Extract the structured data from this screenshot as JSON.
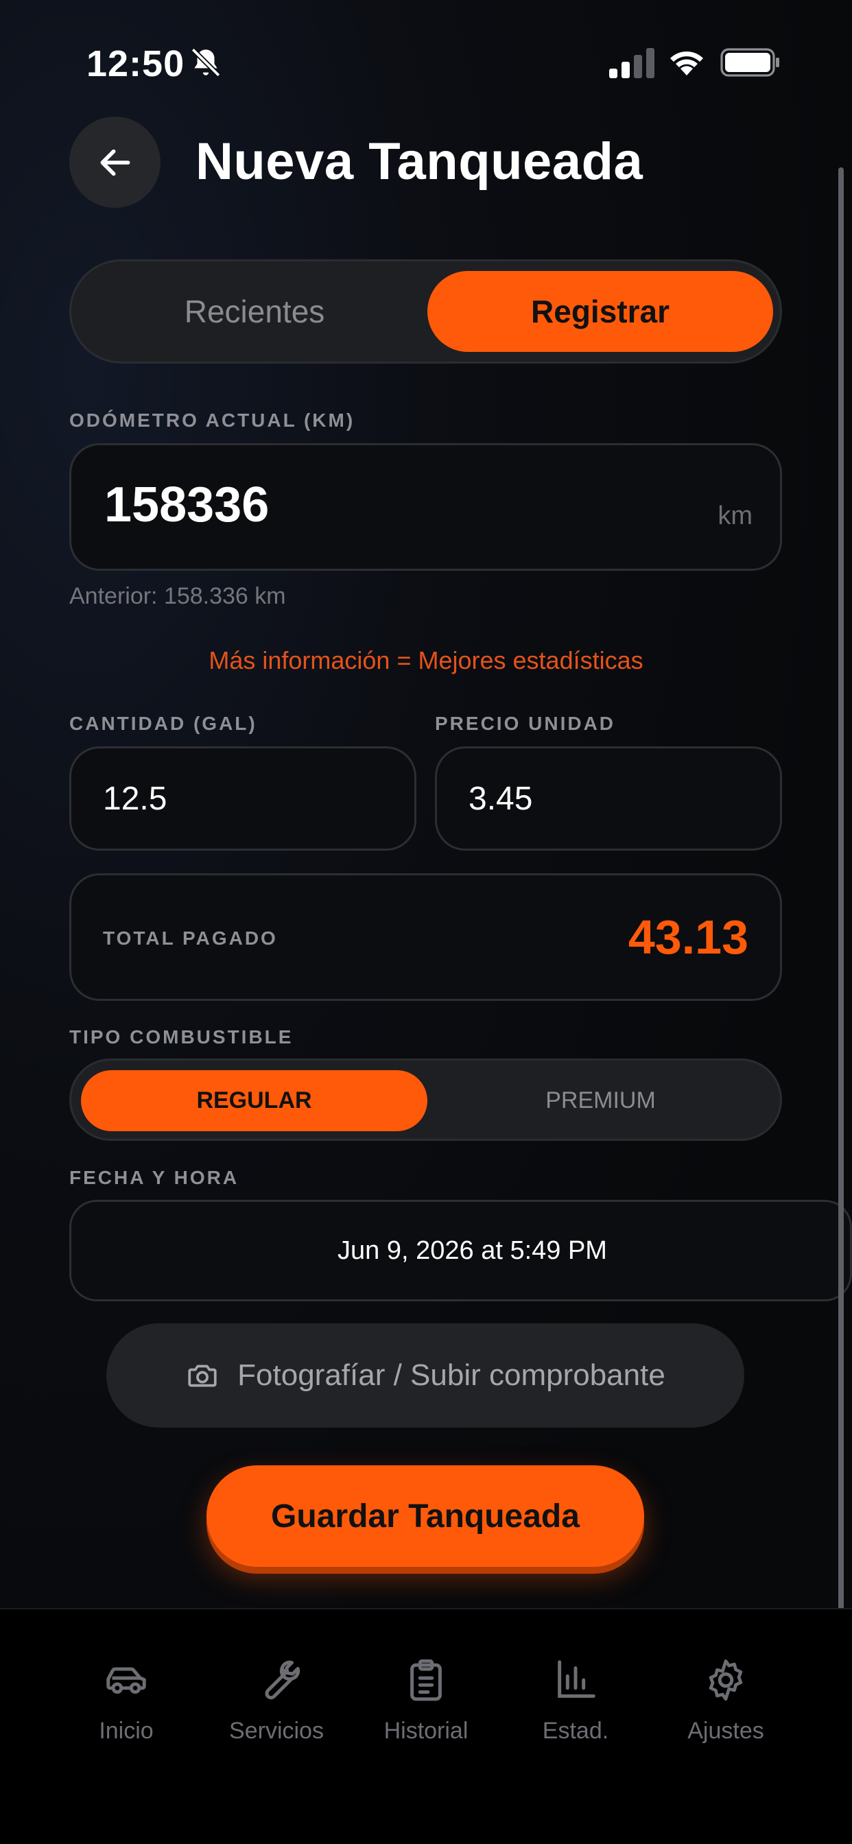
{
  "status_bar": {
    "time": "12:50"
  },
  "header": {
    "title": "Nueva Tanqueada"
  },
  "tabs": [
    {
      "label": "Recientes",
      "selected": false
    },
    {
      "label": "Registrar",
      "selected": true
    }
  ],
  "odometer": {
    "label": "ODÓMETRO ACTUAL (KM)",
    "value": "158336",
    "unit": "km",
    "previous": "Anterior: 158.336 km"
  },
  "info_hint": "Más información = Mejores estadísticas",
  "quantity": {
    "label": "CANTIDAD (GAL)",
    "value": "12.5"
  },
  "unit_price": {
    "label": "PRECIO UNIDAD",
    "value": "3.45"
  },
  "total": {
    "label": "TOTAL PAGADO",
    "value": "43.13"
  },
  "fuel_type": {
    "label": "TIPO COMBUSTIBLE",
    "options": [
      {
        "label": "REGULAR",
        "selected": true
      },
      {
        "label": "PREMIUM",
        "selected": false
      }
    ]
  },
  "datetime": {
    "label": "FECHA Y HORA",
    "value": "Jun 9, 2026 at 5:49 PM"
  },
  "upload_button": {
    "label": "Fotografíar / Subir comprobante",
    "icon": "camera-icon"
  },
  "save_button": {
    "label": "Guardar Tanqueada"
  },
  "bottom_nav": [
    {
      "label": "Inicio",
      "icon": "car-icon"
    },
    {
      "label": "Servicios",
      "icon": "wrench-icon"
    },
    {
      "label": "Historial",
      "icon": "clipboard-icon"
    },
    {
      "label": "Estad.",
      "icon": "chart-icon"
    },
    {
      "label": "Ajustes",
      "icon": "gear-icon"
    }
  ],
  "colors": {
    "accent": "#ff5a0a",
    "background": "#08090b",
    "surface": "#1e1f22"
  }
}
